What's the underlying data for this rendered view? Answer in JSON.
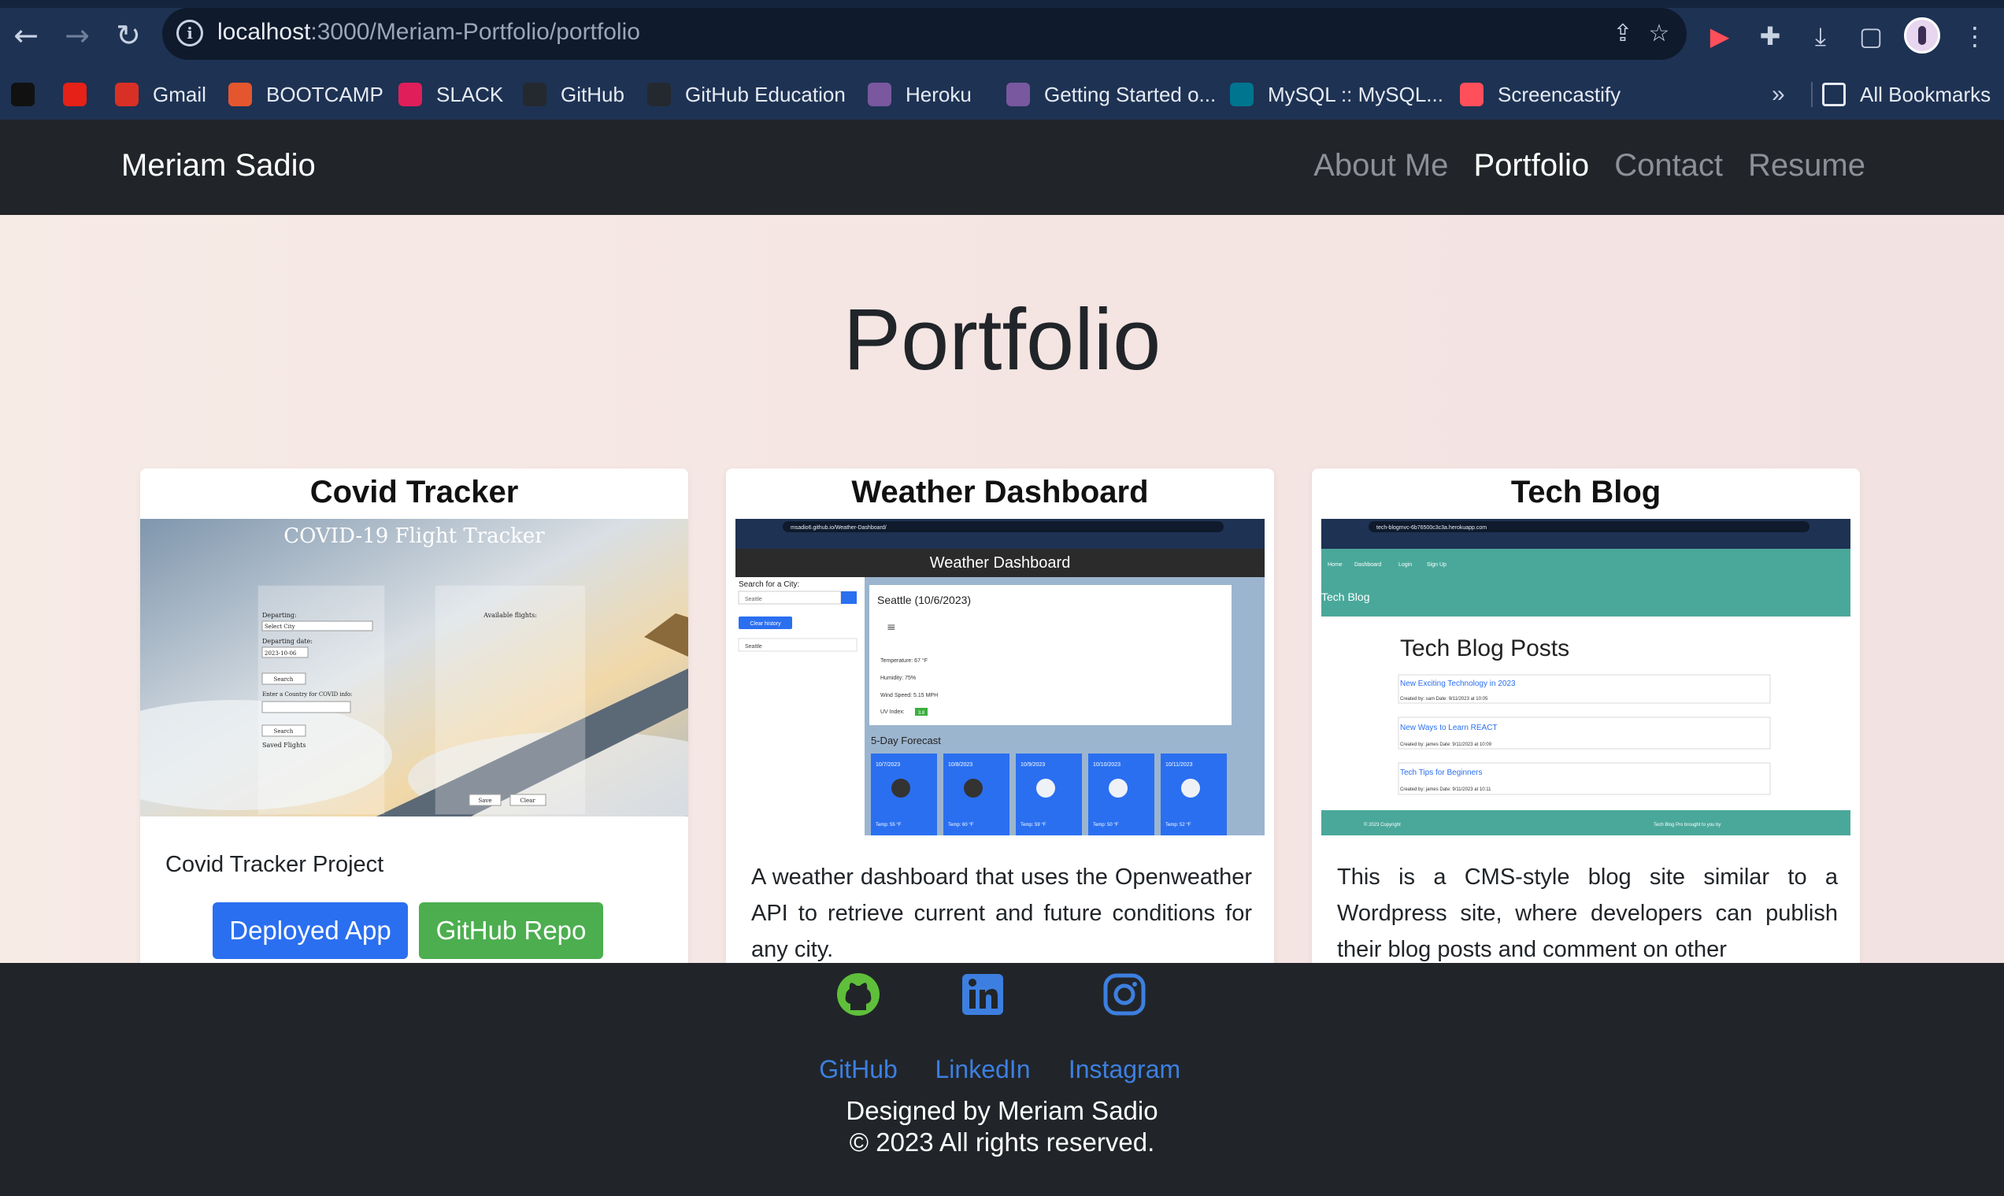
{
  "browser": {
    "url_host": "localhost",
    "url_path": ":3000/Meriam-Portfolio/portfolio",
    "bookmarks": [
      {
        "label": "",
        "color": "#111111"
      },
      {
        "label": "",
        "color": "#e62117"
      },
      {
        "label": "Gmail",
        "color": "#d93025"
      },
      {
        "label": "BOOTCAMP",
        "color": "#e4572e"
      },
      {
        "label": "SLACK",
        "color": "#e01e5a"
      },
      {
        "label": "GitHub",
        "color": "#24292f"
      },
      {
        "label": "GitHub Education",
        "color": "#24292f"
      },
      {
        "label": "Heroku",
        "color": "#79589f"
      },
      {
        "label": "Getting Started o...",
        "color": "#79589f"
      },
      {
        "label": "MySQL :: MySQL...",
        "color": "#00758f"
      },
      {
        "label": "Screencastify",
        "color": "#ff4f5a"
      }
    ],
    "overflow": "»",
    "all_bookmarks": "All Bookmarks"
  },
  "site": {
    "brand": "Meriam Sadio",
    "nav": [
      "About Me",
      "Portfolio",
      "Contact",
      "Resume"
    ],
    "active_nav": "Portfolio"
  },
  "page": {
    "title": "Portfolio"
  },
  "projects": [
    {
      "title": "Covid Tracker",
      "description": "Covid Tracker Project",
      "deployed_label": "Deployed App",
      "repo_label": "GitHub Repo",
      "thumb": {
        "heading": "COVID-19 Flight Tracker",
        "departing": "Departing:",
        "select_city": "Select City",
        "departing_date": "Departing date:",
        "date": "2023-10-06",
        "search": "Search",
        "enter_country": "Enter a Country for COVID info:",
        "search2": "Search",
        "saved": "Saved Flights",
        "available": "Available flights:",
        "save": "Save",
        "clear": "Clear"
      }
    },
    {
      "title": "Weather Dashboard",
      "description": "A weather dashboard that uses the Openweather API to retrieve current and future conditions for any city.",
      "thumb": {
        "url": "msadio6.github.io/Weather-Dashboard/",
        "header": "Weather Dashboard",
        "search_label": "Search for a City:",
        "search_value": "Seattle",
        "clear_history": "Clear history",
        "history_item": "Seattle",
        "current_title": "Seattle (10/6/2023)",
        "temp": "Temperature: 67 °F",
        "humidity": "Humidity: 75%",
        "wind": "Wind Speed: 5.15 MPH",
        "uv": "UV Index:",
        "uv_value": "3.8",
        "forecast_title": "5-Day Forecast",
        "forecast": [
          {
            "date": "10/7/2023",
            "temp": "Temp: 55 °F"
          },
          {
            "date": "10/8/2023",
            "temp": "Temp: 60 °F"
          },
          {
            "date": "10/9/2023",
            "temp": "Temp: 59 °F"
          },
          {
            "date": "10/10/2023",
            "temp": "Temp: 50 °F"
          },
          {
            "date": "10/11/2023",
            "temp": "Temp: 52 °F"
          }
        ]
      }
    },
    {
      "title": "Tech Blog",
      "description": "This is a CMS-style blog site similar to a Wordpress site, where developers can publish their blog posts and comment on other",
      "thumb": {
        "url": "tech-blogmvc-6b76500c3c3a.herokuapp.com",
        "nav": [
          "Home",
          "Dashboard",
          "Login",
          "Sign Up"
        ],
        "brand": "Tech Blog",
        "heading": "Tech Blog Posts",
        "posts": [
          {
            "title": "New Exciting Technology in 2023",
            "meta": "Created by: sam Date: 9/11/2023 at 10:05"
          },
          {
            "title": "New Ways to Learn REACT",
            "meta": "Created by: james Date: 9/11/2023 at 10:09"
          },
          {
            "title": "Tech Tips for Beginners",
            "meta": "Created by: james Date: 9/11/2023 at 10:11"
          }
        ],
        "footer_left": "© 2023 Copyright",
        "footer_right": "Tech Blog Pro brought to you by"
      }
    }
  ],
  "footer": {
    "links": [
      "GitHub",
      "LinkedIn",
      "Instagram"
    ],
    "icon_colors": [
      "#5fbf3a",
      "#3d7fe0",
      "#3d7fe0"
    ],
    "designed_by": "Designed by Meriam Sadio",
    "copyright": "© 2023 All rights reserved."
  },
  "colors": {
    "primary": "#0d6efd",
    "success": "#4cae4f",
    "dark": "#212529"
  }
}
